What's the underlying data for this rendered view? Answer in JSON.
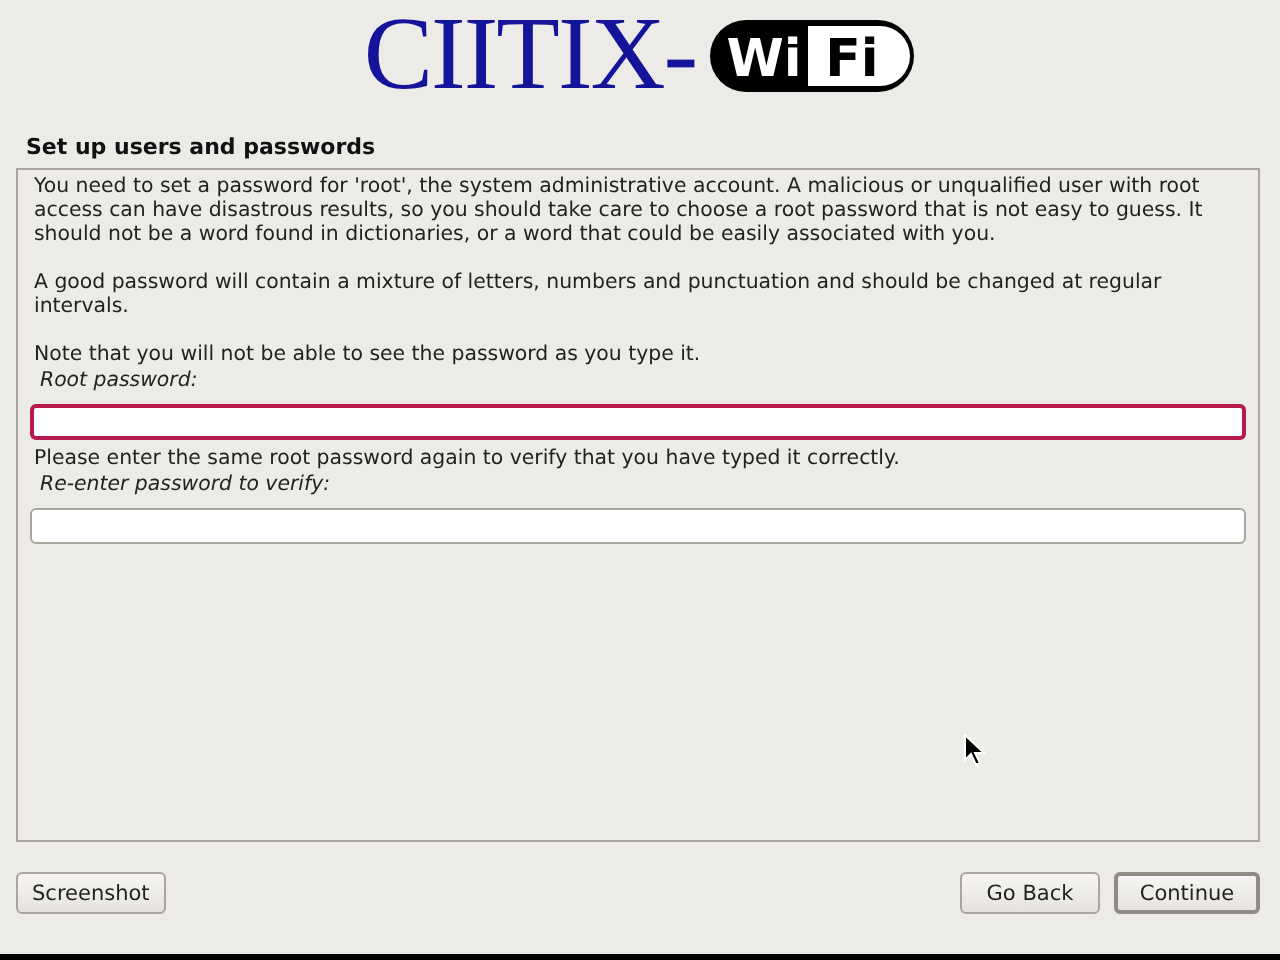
{
  "logo": {
    "name": "CIITIX-",
    "badge": [
      "Wi",
      "Fi"
    ]
  },
  "title": "Set up users and passwords",
  "paragraphs": [
    "You need to set a password for 'root', the system administrative account. A malicious or unqualified user with root access can have disastrous results, so you should take care to choose a root password that is not easy to guess. It should not be a word found in dictionaries, or a word that could be easily associated with you.",
    "A good password will contain a mixture of letters, numbers and punctuation and should be changed at regular intervals.",
    "Note that you will not be able to see the password as you type it."
  ],
  "fields": [
    {
      "label": "Root password:",
      "focused": true
    },
    {
      "note": "Please enter the same root password again to verify that you have typed it correctly.",
      "label": "Re-enter password to verify:",
      "focused": false
    }
  ],
  "buttons": [
    {
      "label": "Screenshot",
      "kind": "left",
      "selected": false
    },
    {
      "label": "Go Back",
      "kind": "right",
      "selected": false
    },
    {
      "label": "Continue",
      "kind": "right",
      "selected": true
    }
  ]
}
